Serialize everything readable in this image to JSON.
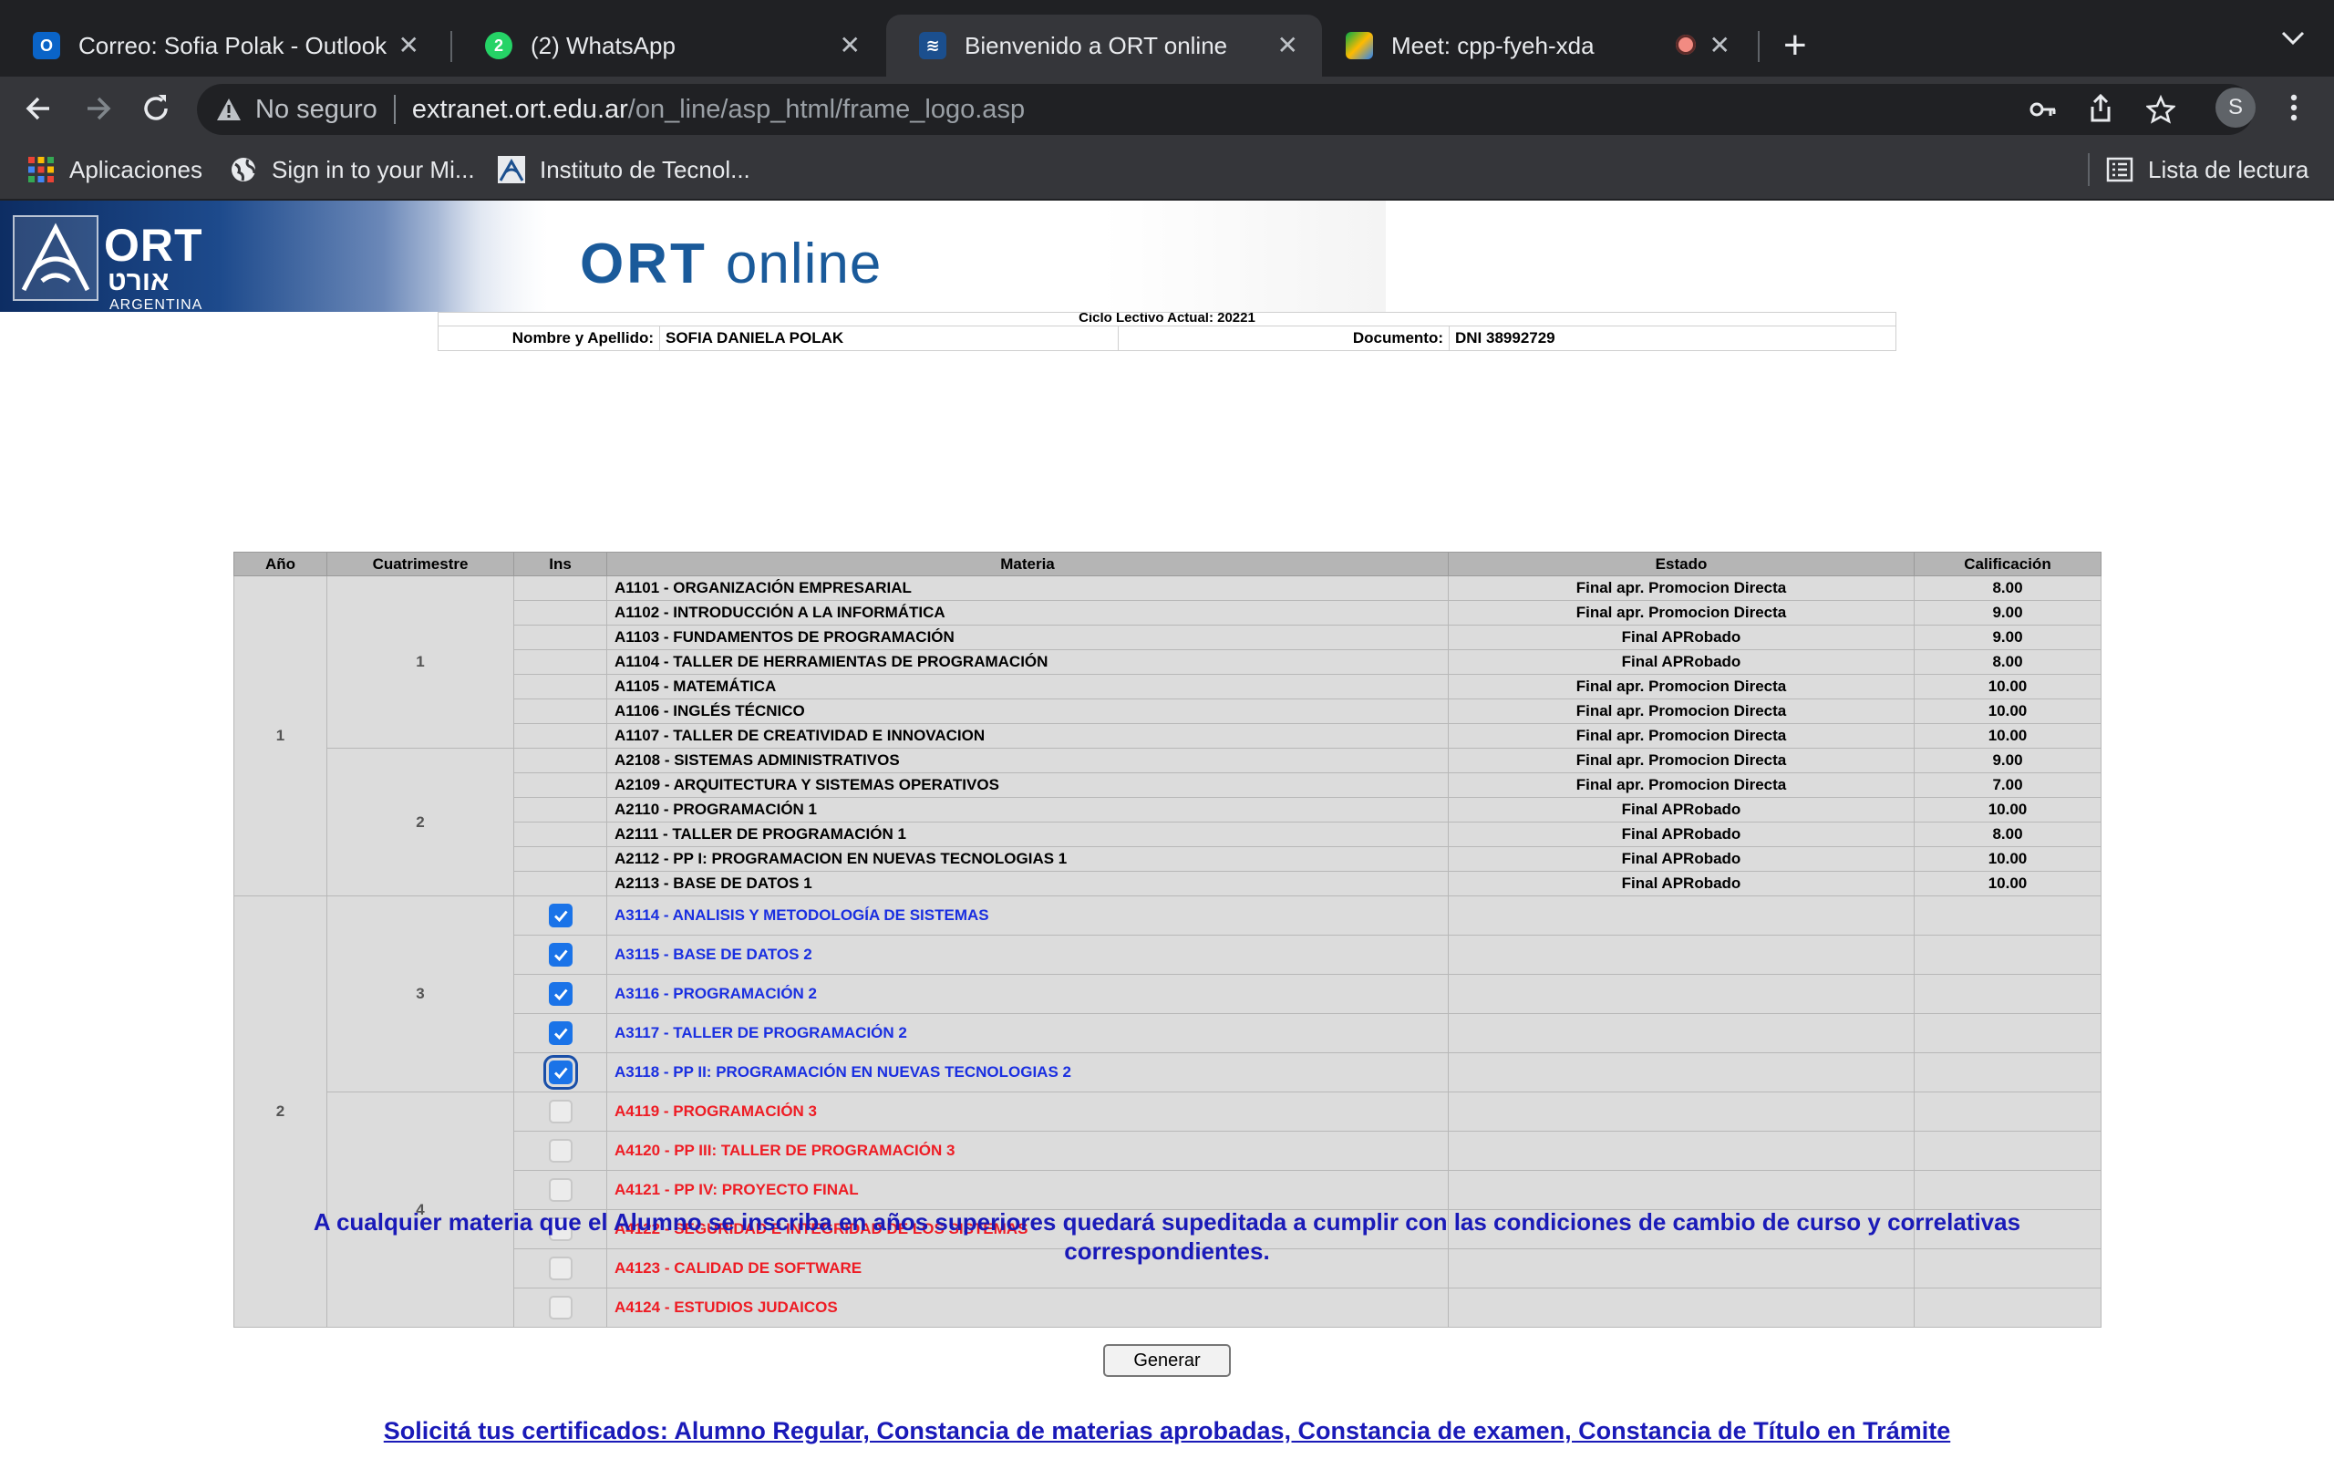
{
  "browser": {
    "tabs": [
      {
        "title": "Correo: Sofia Polak - Outlook",
        "icon": "outlook-icon",
        "active": false
      },
      {
        "title": "(2) WhatsApp",
        "icon": "whatsapp-icon",
        "badge": "2",
        "active": false
      },
      {
        "title": "Bienvenido a ORT online",
        "icon": "ort-icon",
        "active": true
      },
      {
        "title": "Meet: cpp-fyeh-xda",
        "icon": "meet-icon",
        "recording": true,
        "active": false
      }
    ],
    "security_label": "No seguro",
    "url_host": "extranet.ort.edu.ar",
    "url_path": "/on_line/asp_html/frame_logo.asp",
    "profile_initial": "S",
    "bookmarks": [
      {
        "label": "Aplicaciones",
        "icon": "apps-grid-icon"
      },
      {
        "label": "Sign in to your Mi...",
        "icon": "globe-icon"
      },
      {
        "label": "Instituto de Tecnol...",
        "icon": "ort-icon"
      }
    ],
    "reading_list": "Lista de lectura"
  },
  "banner": {
    "logo_text": "ORT",
    "logo_hebrew": "אורט",
    "logo_country": "ARGENTINA",
    "title_bold": "ORT",
    "title_rest": "online"
  },
  "student": {
    "ciclo_label": "Ciclo Lectivo Actual:",
    "ciclo_value": "20221",
    "name_label": "Nombre y Apellido:",
    "name_value": "SOFIA DANIELA POLAK",
    "doc_label": "Documento:",
    "doc_value": "DNI 38992729"
  },
  "table": {
    "headers": [
      "Año",
      "Cuatrimestre",
      "Ins",
      "Materia",
      "Estado",
      "Calificación"
    ],
    "rows": [
      {
        "anio": "1",
        "cuat": "1",
        "materia": "A1101 - ORGANIZACIÓN EMPRESARIAL",
        "estado": "Final apr. Promocion Directa",
        "calif": "8.00"
      },
      {
        "materia": "A1102 - INTRODUCCIÓN A LA INFORMÁTICA",
        "estado": "Final apr. Promocion Directa",
        "calif": "9.00"
      },
      {
        "materia": "A1103 - FUNDAMENTOS DE PROGRAMACIÓN",
        "estado": "Final APRobado",
        "calif": "9.00"
      },
      {
        "materia": "A1104 - TALLER DE HERRAMIENTAS DE PROGRAMACIÓN",
        "estado": "Final APRobado",
        "calif": "8.00"
      },
      {
        "materia": "A1105 - MATEMÁTICA",
        "estado": "Final apr. Promocion Directa",
        "calif": "10.00"
      },
      {
        "materia": "A1106 - INGLÉS TÉCNICO",
        "estado": "Final apr. Promocion Directa",
        "calif": "10.00"
      },
      {
        "materia": "A1107 - TALLER DE CREATIVIDAD E INNOVACION",
        "estado": "Final apr. Promocion Directa",
        "calif": "10.00"
      },
      {
        "cuat": "2",
        "materia": "A2108 - SISTEMAS ADMINISTRATIVOS",
        "estado": "Final apr. Promocion Directa",
        "calif": "9.00"
      },
      {
        "materia": "A2109 - ARQUITECTURA Y SISTEMAS OPERATIVOS",
        "estado": "Final apr. Promocion Directa",
        "calif": "7.00"
      },
      {
        "materia": "A2110 - PROGRAMACIÓN 1",
        "estado": "Final APRobado",
        "calif": "10.00"
      },
      {
        "materia": "A2111 - TALLER DE PROGRAMACIÓN 1",
        "estado": "Final APRobado",
        "calif": "8.00"
      },
      {
        "materia": "A2112 - PP I: PROGRAMACION EN NUEVAS TECNOLOGIAS 1",
        "estado": "Final APRobado",
        "calif": "10.00"
      },
      {
        "materia": "A2113 - BASE DE DATOS 1",
        "estado": "Final APRobado",
        "calif": "10.00"
      }
    ],
    "enroll_rows": [
      {
        "anio": "2",
        "cuat": "3",
        "materia": "A3114 - ANALISIS Y METODOLOGÍA DE SISTEMAS",
        "checked": true,
        "color": "blue"
      },
      {
        "materia": "A3115 - BASE DE DATOS 2",
        "checked": true,
        "color": "blue"
      },
      {
        "materia": "A3116 - PROGRAMACIÓN 2",
        "checked": true,
        "color": "blue"
      },
      {
        "materia": "A3117 - TALLER DE PROGRAMACIÓN 2",
        "checked": true,
        "color": "blue"
      },
      {
        "materia": "A3118 - PP II: PROGRAMACIÓN EN NUEVAS TECNOLOGIAS 2",
        "checked": true,
        "focused": true,
        "color": "blue"
      },
      {
        "cuat": "4",
        "materia": "A4119 - PROGRAMACIÓN 3",
        "checked": false,
        "color": "red"
      },
      {
        "materia": "A4120 - PP III: TALLER DE PROGRAMACIÓN 3",
        "checked": false,
        "color": "red"
      },
      {
        "materia": "A4121 - PP IV: PROYECTO FINAL",
        "checked": false,
        "color": "red"
      },
      {
        "materia": "A4122 - SEGURIDAD E INTEGRIDAD DE LOS SISTEMAS",
        "checked": false,
        "color": "red"
      },
      {
        "materia": "A4123 - CALIDAD DE SOFTWARE",
        "checked": false,
        "color": "red"
      },
      {
        "materia": "A4124 - ESTUDIOS JUDAICOS",
        "checked": false,
        "color": "red"
      }
    ]
  },
  "notice": "A cualquier materia que el Alumno se inscriba en años superiores quedará supeditada a cumplir con las condiciones de cambio de curso y correlativas correspondientes.",
  "generate_button": "Generar",
  "cert_link": "Solicitá tus certificados: Alumno Regular, Constancia de materias aprobadas, Constancia de examen, Constancia de Título en Trámite",
  "colors": {
    "link_blue": "#1a1ab8",
    "enroll_blue": "#1a2fe0",
    "pending_red": "#ee1c24",
    "checkbox_blue": "#1a73e8",
    "brand_blue": "#1a5a9a"
  }
}
